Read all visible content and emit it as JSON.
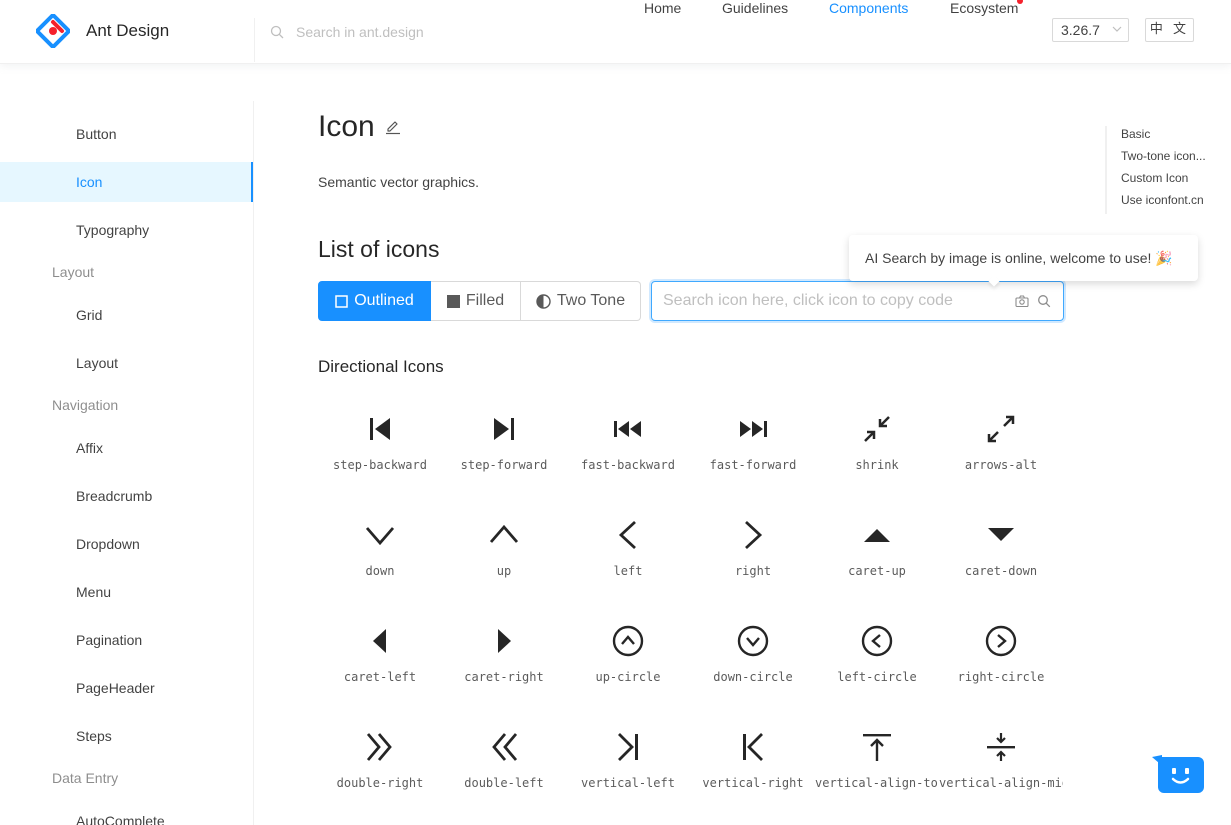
{
  "header": {
    "logo_text": "Ant Design",
    "search_placeholder": "Search in ant.design",
    "nav": [
      "Home",
      "Guidelines",
      "Components",
      "Ecosystem"
    ],
    "active_nav": "Components",
    "version": "3.26.7",
    "lang": "中 文"
  },
  "sidebar": {
    "items": [
      {
        "type": "item",
        "label": "Button"
      },
      {
        "type": "item",
        "label": "Icon",
        "active": true
      },
      {
        "type": "item",
        "label": "Typography"
      },
      {
        "type": "group",
        "label": "Layout"
      },
      {
        "type": "item",
        "label": "Grid"
      },
      {
        "type": "item",
        "label": "Layout"
      },
      {
        "type": "group",
        "label": "Navigation"
      },
      {
        "type": "item",
        "label": "Affix"
      },
      {
        "type": "item",
        "label": "Breadcrumb"
      },
      {
        "type": "item",
        "label": "Dropdown"
      },
      {
        "type": "item",
        "label": "Menu"
      },
      {
        "type": "item",
        "label": "Pagination"
      },
      {
        "type": "item",
        "label": "PageHeader"
      },
      {
        "type": "item",
        "label": "Steps"
      },
      {
        "type": "group",
        "label": "Data Entry"
      },
      {
        "type": "item",
        "label": "AutoComplete"
      }
    ]
  },
  "main": {
    "title": "Icon",
    "description": "Semantic vector graphics.",
    "list_title": "List of icons",
    "theme_buttons": [
      "Outlined",
      "Filled",
      "Two Tone"
    ],
    "active_theme": "Outlined",
    "icon_search_placeholder": "Search icon here, click icon to copy code",
    "tooltip": "AI Search by image is online, welcome to use! 🎉",
    "section_title": "Directional Icons",
    "icons": [
      "step-backward",
      "step-forward",
      "fast-backward",
      "fast-forward",
      "shrink",
      "arrows-alt",
      "down",
      "up",
      "left",
      "right",
      "caret-up",
      "caret-down",
      "caret-left",
      "caret-right",
      "up-circle",
      "down-circle",
      "left-circle",
      "right-circle",
      "double-right",
      "double-left",
      "vertical-left",
      "vertical-right",
      "vertical-align-top",
      "vertical-align-middle"
    ]
  },
  "anchor": [
    "Basic",
    "Two-tone icon...",
    "Custom Icon",
    "Use iconfont.cn"
  ],
  "colors": {
    "primary": "#1890ff",
    "active_bg": "#e6f7ff",
    "dot": "#f5222d"
  }
}
